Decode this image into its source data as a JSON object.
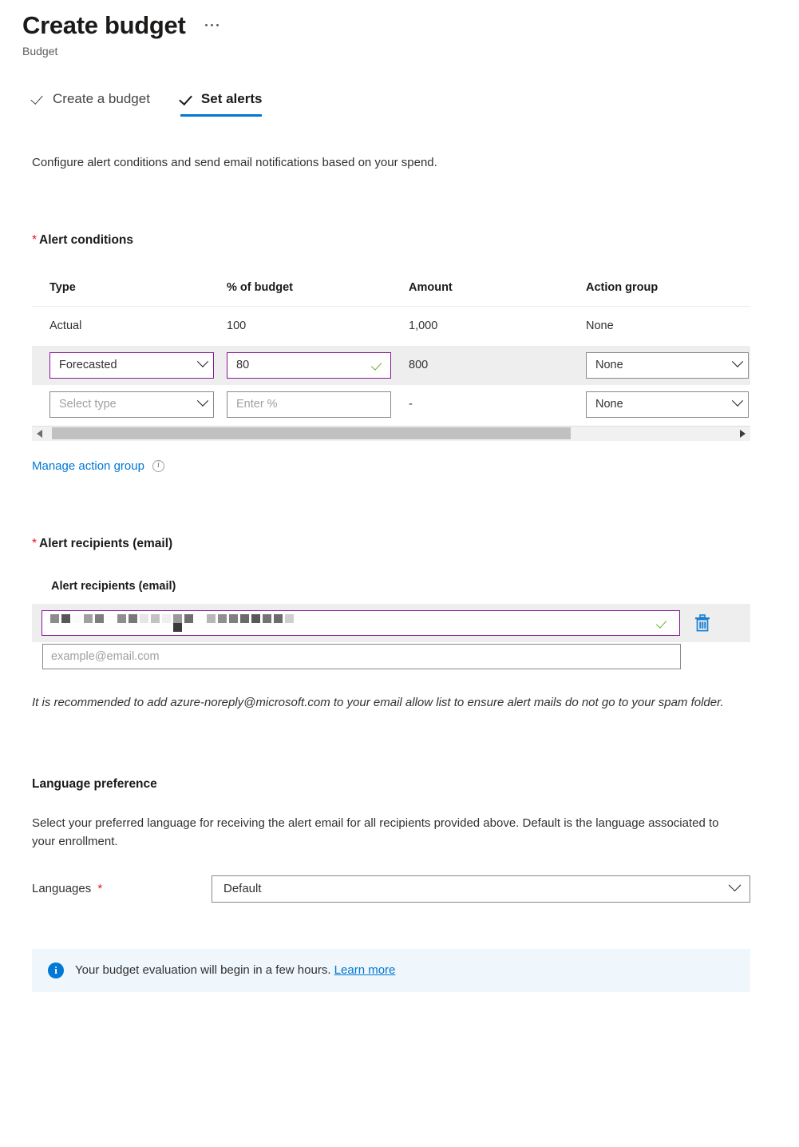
{
  "header": {
    "title": "Create budget",
    "subtitle": "Budget",
    "overflow_menu": "..."
  },
  "tabs": [
    {
      "label": "Create a budget",
      "state": "completed",
      "active": false
    },
    {
      "label": "Set alerts",
      "state": "completed",
      "active": true
    }
  ],
  "intro": "Configure alert conditions and send email notifications based on your spend.",
  "alert_conditions": {
    "section_label": "Alert conditions",
    "required": true,
    "columns": [
      "Type",
      "% of budget",
      "Amount",
      "Action group"
    ],
    "rows": [
      {
        "kind": "static",
        "type": "Actual",
        "percent": "100",
        "amount": "1,000",
        "action_group": "None"
      },
      {
        "kind": "editable",
        "type": "Forecasted",
        "percent": "80",
        "percent_valid": true,
        "amount": "800",
        "action_group": "None"
      },
      {
        "kind": "editable",
        "type_placeholder": "Select type",
        "percent_placeholder": "Enter %",
        "amount": "-",
        "action_group": "None"
      }
    ],
    "manage_link": "Manage action group",
    "scrollbar": {
      "thumb_left_pct": 2.8,
      "thumb_width_pct": 72
    }
  },
  "alert_recipients": {
    "section_label": "Alert recipients (email)",
    "required": true,
    "field_label": "Alert recipients (email)",
    "entries": [
      {
        "value_redacted": true,
        "valid": true,
        "delete_label": "Delete"
      }
    ],
    "new_entry_placeholder": "example@email.com",
    "note": "It is recommended to add azure-noreply@microsoft.com to your email allow list to ensure alert mails do not go to your spam folder."
  },
  "language_preference": {
    "heading": "Language preference",
    "description": "Select your preferred language for receiving the alert email for all recipients provided above. Default is the language associated to your enrollment.",
    "field_label": "Languages",
    "required": true,
    "selected": "Default"
  },
  "banner": {
    "icon": "info-icon",
    "text": "Your budget evaluation will begin in a few hours.",
    "link_label": "Learn more"
  },
  "colors": {
    "accent_blue": "#0078d4",
    "focus_purple": "#881798",
    "valid_green": "#5cb226",
    "required_red": "#e81123",
    "banner_bg": "#eff6fc",
    "striped_row": "#eeeeee"
  }
}
